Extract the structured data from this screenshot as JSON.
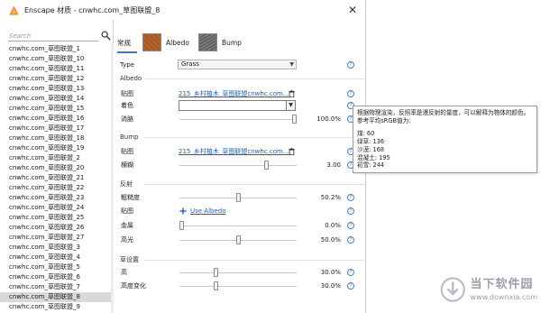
{
  "window": {
    "title": "Enscape 材质 - cnwhc.com_草图联盟_8",
    "close_glyph": "✕"
  },
  "search": {
    "placeholder": "Search"
  },
  "materials": [
    "cnwhc.com_草图联盟_1",
    "cnwhc.com_草图联盟_10",
    "cnwhc.com_草图联盟_11",
    "cnwhc.com_草图联盟_12",
    "cnwhc.com_草图联盟_13",
    "cnwhc.com_草图联盟_14",
    "cnwhc.com_草图联盟_15",
    "cnwhc.com_草图联盟_16",
    "cnwhc.com_草图联盟_17",
    "cnwhc.com_草图联盟_18",
    "cnwhc.com_草图联盟_19",
    "cnwhc.com_草图联盟_2",
    "cnwhc.com_草图联盟_20",
    "cnwhc.com_草图联盟_21",
    "cnwhc.com_草图联盟_22",
    "cnwhc.com_草图联盟_23",
    "cnwhc.com_草图联盟_24",
    "cnwhc.com_草图联盟_25",
    "cnwhc.com_草图联盟_26",
    "cnwhc.com_草图联盟_27",
    "cnwhc.com_草图联盟_3",
    "cnwhc.com_草图联盟_4",
    "cnwhc.com_草图联盟_5",
    "cnwhc.com_草图联盟_6",
    "cnwhc.com_草图联盟_7",
    "cnwhc.com_草图联盟_8",
    "cnwhc.com_草图联盟_9"
  ],
  "selected_material": "cnwhc.com_草图联盟_8",
  "tabs": [
    {
      "label": "常规"
    },
    {
      "label": "Albedo"
    },
    {
      "label": "Bump"
    }
  ],
  "general": {
    "type_label": "Type",
    "type_value": "Grass"
  },
  "albedo": {
    "section": "Albedo",
    "texture_label": "贴图",
    "texture_file": "215_乡村植木_草图联盟cnwhc.com...",
    "tint_label": "着色",
    "fade_label": "淌胳",
    "fade_value": "100.0%",
    "fade_level": 1.0
  },
  "bump": {
    "section": "Bump",
    "texture_label": "贴图",
    "texture_file": "215_乡村植木_草图联盟cnwhc.com...",
    "amount_label": "横糊",
    "amount_value": "3.00",
    "amount_level": 0.75
  },
  "reflection": {
    "section": "反射",
    "roughness_label": "粗糙度",
    "roughness_value": "50.2%",
    "roughness_level": 0.502,
    "map_label": "贴图",
    "use_albedo": "Use Albedo",
    "metallic_label": "金属",
    "metallic_value": "0.0%",
    "metallic_level": 0.0,
    "specular_label": "高光",
    "specular_value": "50.0%",
    "specular_level": 0.5
  },
  "grass": {
    "section": "草设置",
    "height_label": "高",
    "height_value": "30.0%",
    "height_level": 0.3,
    "variation_label": "高度变化",
    "variation_value": "30.0%",
    "variation_level": 0.3
  },
  "help_glyph": "?",
  "tooltip": {
    "line1": "根据物理渲染，反照率是漫反射的量度，可以解释为物体的颜色。",
    "line2": "参考平均sRGB值为:",
    "values": [
      "煤: 60",
      "绿草: 136",
      "沙漠: 168",
      "混凝土: 195",
      "初雪: 244"
    ]
  },
  "watermark": {
    "name": "当下软件园",
    "url": "www.downxia.com"
  },
  "colors": {
    "accent": "#3c78c8",
    "link": "#1d5fbf",
    "selected_row": "#d9d9d9"
  }
}
